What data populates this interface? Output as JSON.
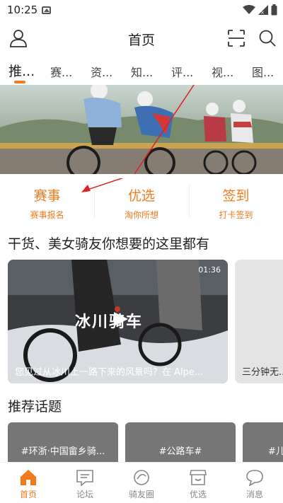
{
  "status_bar": {
    "time": "10:25"
  },
  "header": {
    "title": "首页"
  },
  "tabs": [
    "推...",
    "赛...",
    "资...",
    "知...",
    "评...",
    "视...",
    "图..."
  ],
  "quick_entries": [
    {
      "title": "赛事",
      "subtitle": "赛事报名"
    },
    {
      "title": "优选",
      "subtitle": "淘你所想"
    },
    {
      "title": "签到",
      "subtitle": "打卡签到"
    }
  ],
  "section_video_title": "干货、美女骑友你想要的这里都有",
  "videos": [
    {
      "overlay_text": "冰川骑车",
      "duration": "01:36",
      "caption": "您见过从冰川上一路下来的风景吗？在 Alpe..."
    },
    {
      "caption": "三分钟无..."
    }
  ],
  "section_topics_title": "推荐话题",
  "topics": [
    "#环浙·中国畲乡骑...",
    "#公路车#",
    "#儿..."
  ],
  "bottom_nav": [
    {
      "label": "首页",
      "icon": "home-icon",
      "active": true
    },
    {
      "label": "论坛",
      "icon": "forum-icon",
      "active": false
    },
    {
      "label": "骑友圈",
      "icon": "circle-icon",
      "active": false
    },
    {
      "label": "优选",
      "icon": "shop-icon",
      "active": false
    },
    {
      "label": "消息",
      "icon": "message-icon",
      "active": false
    }
  ],
  "colors": {
    "accent": "#f07a1c",
    "annotation_arrow": "#e02020"
  }
}
